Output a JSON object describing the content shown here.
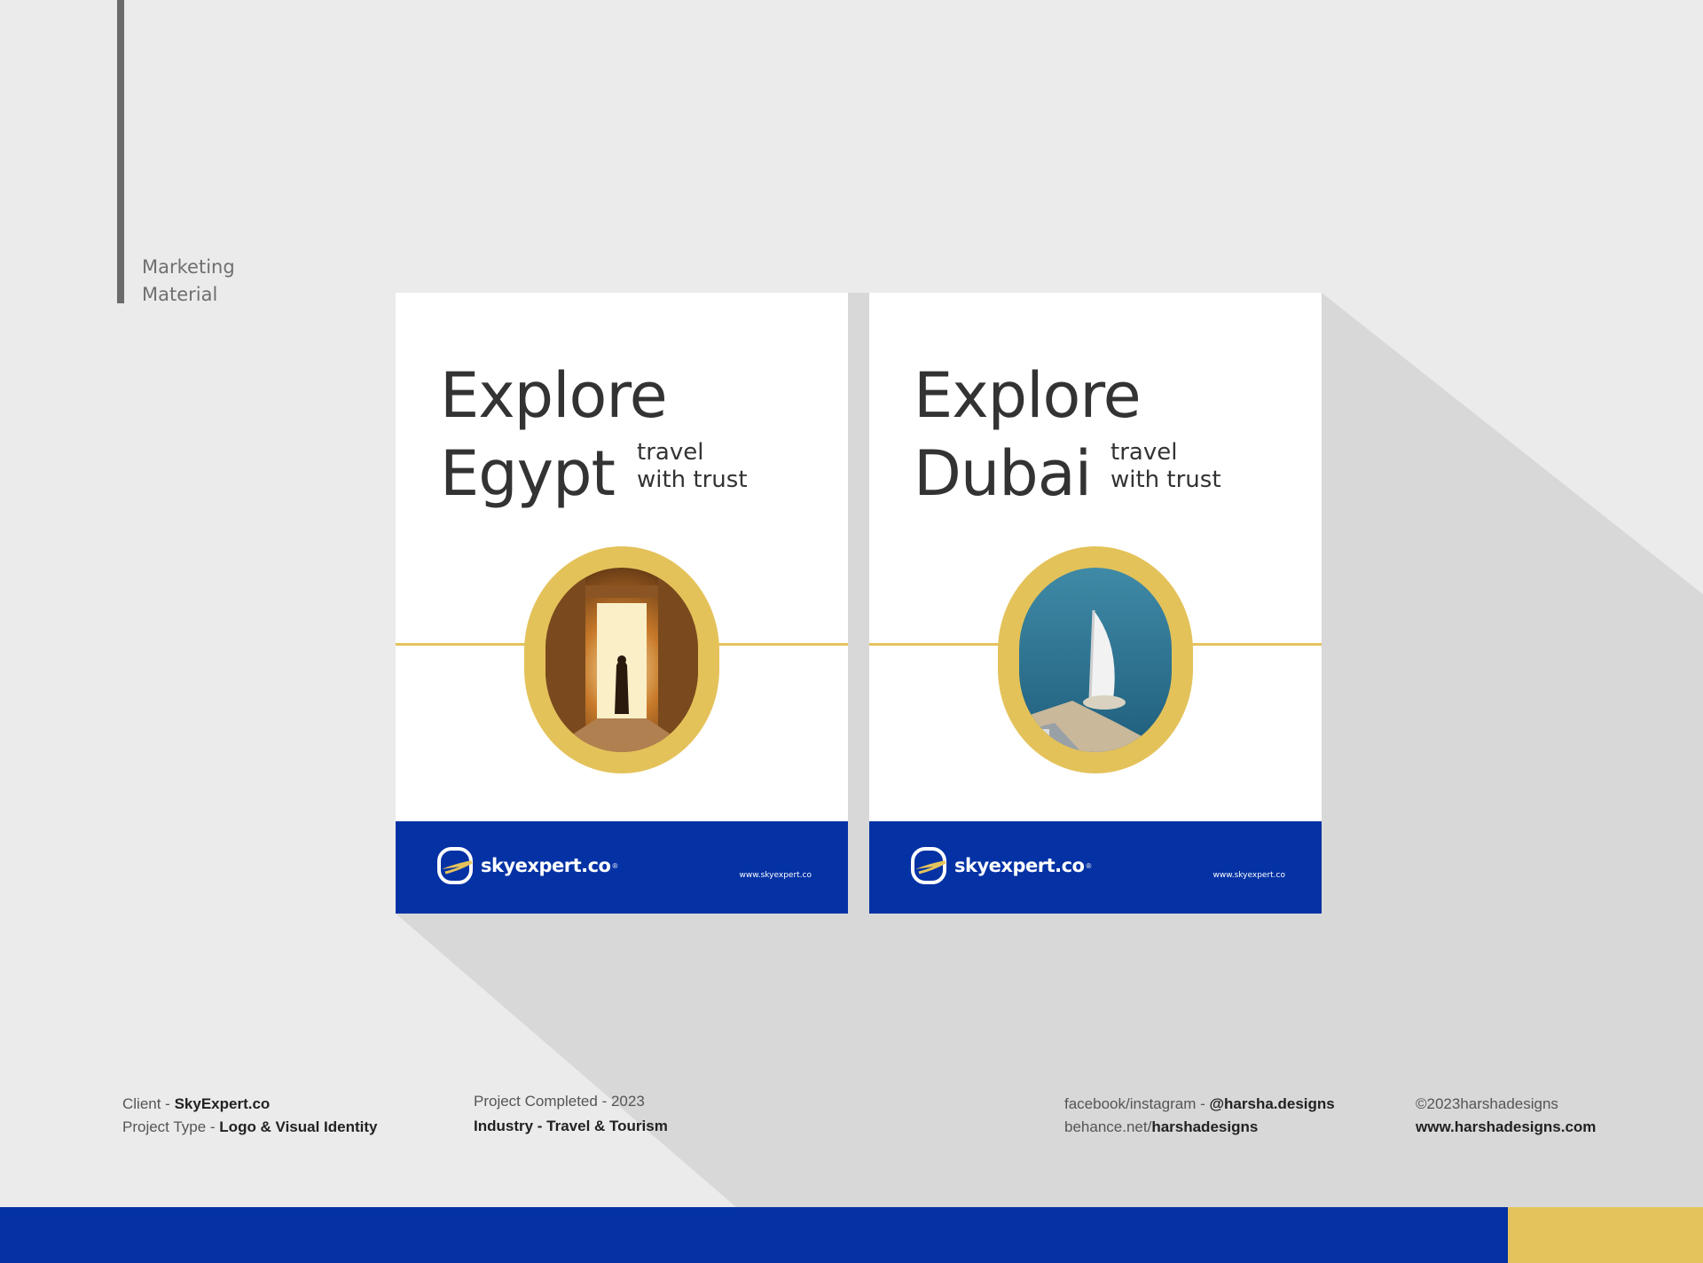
{
  "section": {
    "line1": "Marketing",
    "line2": "Material"
  },
  "posters": [
    {
      "headline_line1": "Explore",
      "headline_line2": "Egypt",
      "tagline_line1": "travel",
      "tagline_line2": "with trust",
      "photo": "egypt-temple-doorway-photo",
      "brand": "skyexpert.co",
      "brand_mark": "®",
      "website": "www.skyexpert.co"
    },
    {
      "headline_line1": "Explore",
      "headline_line2": "Dubai",
      "tagline_line1": "travel",
      "tagline_line2": "with trust",
      "photo": "dubai-burj-al-arab-aerial-photo",
      "brand": "skyexpert.co",
      "brand_mark": "®",
      "website": "www.skyexpert.co"
    }
  ],
  "credits": {
    "client_label": "Client - ",
    "client_value": "SkyExpert.co",
    "type_label": "Project Type - ",
    "type_value": "Logo & Visual Identity",
    "completed": "Project Completed - 2023",
    "industry": "Industry - Travel & Tourism",
    "social_label": "facebook/instagram - ",
    "social_value": "@harsha.designs",
    "behance_label": "behance.net/",
    "behance_value": "harshadesigns",
    "copyright": "©2023harshadesigns",
    "website": "www.harshadesigns.com"
  },
  "colors": {
    "blue": "#0432a5",
    "gold": "#e5c35c",
    "background": "#ebebeb",
    "shadow": "#d7d7d7"
  }
}
